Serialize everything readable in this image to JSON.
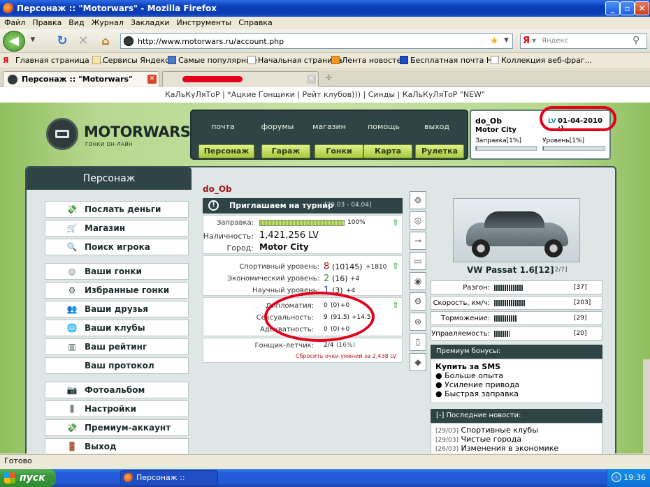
{
  "window": {
    "title": "Персонаж :: \"Motorwars\" - Mozilla Firefox",
    "minimize": "_",
    "restore": "▫",
    "close": "✕"
  },
  "menu": [
    "Файл",
    "Правка",
    "Вид",
    "Журнал",
    "Закладки",
    "Инструменты",
    "Справка"
  ],
  "nav": {
    "url": "http://www.motorwars.ru/account.php",
    "search_placeholder": "Яндекс",
    "search_logo": "Я"
  },
  "bookmarks": [
    "Главная страница Я...",
    "Сервисы Яндекса",
    "Самые популярные",
    "Начальная страница",
    "Лента новостей",
    "Бесплатная почта Н...",
    "Коллекция веб-фраг..."
  ],
  "tabs": {
    "active": "Персонаж :: \"Motorwars\"",
    "close": "✕",
    "new_tab": "✢"
  },
  "site": {
    "top_links": "КаЛьКуЛяТоР | *Ацкие Гонщики | Рейт клубов))) | Синды | КаЛьКуЛяТоР \"NEW\"",
    "logo": "MOTORWARS.RU",
    "logo_sub": "ГОНКИ ОН-ЛАЙН",
    "topnav": [
      "почта",
      "форумы",
      "магазин",
      "помощь",
      "выход"
    ],
    "buttons": [
      "Персонаж",
      "Гараж",
      "Гонки",
      "Карта",
      "Рулетка"
    ],
    "user": {
      "name": "do_Ob",
      "city": "Motor City",
      "lv_label": "LV",
      "lv_date": "01-04-2010 ;)",
      "fuel_label": "Заправка[1%]",
      "level_label": "Уровень[1%]",
      "fuel_pct": 1,
      "level_pct": 1
    }
  },
  "board": {
    "title": "Персонаж",
    "sidebar": [
      {
        "label": "Послать деньги",
        "icon": "💸"
      },
      {
        "label": "Магазин",
        "icon": "🛒"
      },
      {
        "label": "Поиск игрока",
        "icon": "🔍"
      },
      {
        "label": "Ваши гонки",
        "icon": "◎"
      },
      {
        "label": "Избранные гонки",
        "icon": "⚙"
      },
      {
        "label": "Ваши друзья",
        "icon": "👥"
      },
      {
        "label": "Ваши клубы",
        "icon": "🌐"
      },
      {
        "label": "Ваш рейтинг",
        "icon": "▥"
      },
      {
        "label": "Ваш протокол",
        "icon": ""
      },
      {
        "label": "Фотоальбом",
        "icon": "📷"
      },
      {
        "label": "Настройки",
        "icon": "⫼"
      },
      {
        "label": "Премиум-аккаунт",
        "icon": "💸"
      },
      {
        "label": "Выход",
        "icon": "🚪"
      }
    ],
    "player": "do_Ob",
    "tournament": {
      "text": "Приглашаем на турнир",
      "dates": "[29.03 - 04.04]"
    },
    "info": {
      "fuel_label": "Заправка:",
      "fuel_pct_text": "100%",
      "fuel_pct": 100,
      "cash_label": "Наличность:",
      "cash": "1,421,256 LV",
      "city_label": "Город:",
      "city": "Motor City"
    },
    "levels": [
      {
        "label": "Спортивный уровень:",
        "value": "8",
        "extra": "(10145)",
        "delta": "+1810"
      },
      {
        "label": "Экономический уровень:",
        "value": "2",
        "extra": "(16)",
        "delta": "+4"
      },
      {
        "label": "Научный уровень:",
        "value": "1",
        "extra": "(3)",
        "delta": "+4"
      }
    ],
    "skills": [
      {
        "label": "Дипломатия:",
        "value": "0",
        "extra": "(0)",
        "delta": "+0"
      },
      {
        "label": "Сексуальность:",
        "value": "9",
        "extra": "(91.5)",
        "delta": "+14.5"
      },
      {
        "label": "Адекватность:",
        "value": "0",
        "extra": "(0)",
        "delta": "+0"
      }
    ],
    "racer": {
      "label": "Гонщик-летчик:",
      "value": "2/4",
      "extra": "(16%)"
    },
    "reset_text": "Сбросить очки умений за 2,438 LV",
    "car": {
      "name": "VW Passat 1.6[12]",
      "slot": "[2/7]"
    },
    "stats": [
      {
        "label": "Разгон:",
        "value": "[37]",
        "fill": 37
      },
      {
        "label": "Скорость, км/ч:",
        "value": "[203]",
        "fill": 40
      },
      {
        "label": "Торможение:",
        "value": "[29]",
        "fill": 29
      },
      {
        "label": "Управляемость:",
        "value": "[20]",
        "fill": 20
      }
    ],
    "premium": {
      "head": "Премиум бонусы:",
      "title": "Купить за SMS",
      "items": [
        "Больше опыта",
        "Усиление привода",
        "Быстрая заправка"
      ]
    },
    "news": {
      "head": "[-]  Последние новости:",
      "items": [
        {
          "date": "[29/03]",
          "text": "Спортивные клубы"
        },
        {
          "date": "[29/03]",
          "text": "Чистые города"
        },
        {
          "date": "[26/03]",
          "text": "Изменения в экономике"
        }
      ]
    }
  },
  "status": "Готово",
  "taskbar": {
    "start": "пуск",
    "item": "Персонаж :: \"Motorw...",
    "clock": "19:36"
  }
}
